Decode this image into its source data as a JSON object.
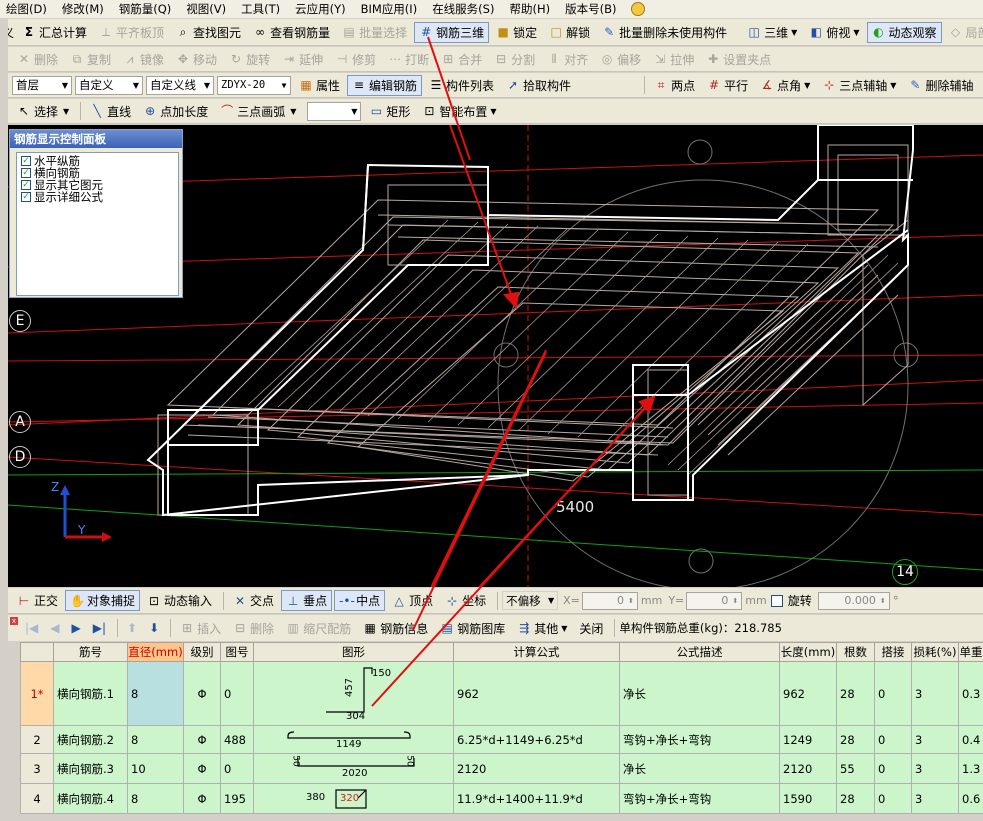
{
  "menu": [
    "绘图(D)",
    "修改(M)",
    "钢筋量(Q)",
    "视图(V)",
    "工具(T)",
    "云应用(Y)",
    "BIM应用(I)",
    "在线服务(S)",
    "帮助(H)",
    "版本号(B)"
  ],
  "toolbar1": {
    "partial_left": "义",
    "sum": "汇总计算",
    "flush": "平齐板顶",
    "find": "查找图元",
    "view_rebar": "查看钢筋量",
    "batch_select": "批量选择",
    "rebar3d": "钢筋三维",
    "lock": "锁定",
    "unlock": "解锁",
    "batch_delete": "批量删除未使用构件",
    "three_d": "三维",
    "top_view": "俯视",
    "orbit": "动态观察",
    "local3d": "局部三维"
  },
  "toolbar2": {
    "delete": "删除",
    "copy": "复制",
    "mirror": "镜像",
    "move": "移动",
    "rotate": "旋转",
    "extend": "延伸",
    "trim": "修剪",
    "break": "打断",
    "merge": "合并",
    "split": "分割",
    "align": "对齐",
    "offset": "偏移",
    "stretch": "拉伸",
    "set_point": "设置夹点"
  },
  "toolbar3": {
    "floor": "首层",
    "cat": "自定义",
    "subcat": "自定义线",
    "code": "ZDYX-20",
    "prop": "属性",
    "edit_rebar": "编辑钢筋",
    "comp_list": "构件列表",
    "pick": "拾取构件",
    "two_pt": "两点",
    "parallel": "平行",
    "pt_angle": "点角",
    "three_pt_axis": "三点辅轴",
    "del_axis": "删除辅轴"
  },
  "toolbar4": {
    "select": "选择",
    "line": "直线",
    "add_len": "点加长度",
    "arc": "三点画弧",
    "rect": "矩形",
    "smart": "智能布置"
  },
  "panel": {
    "title": "钢筋显示控制面板",
    "items": [
      "水平纵筋",
      "横向钢筋",
      "显示其它图元",
      "显示详细公式"
    ]
  },
  "viewport": {
    "axes": [
      "E",
      "A",
      "D"
    ],
    "dim": "5400",
    "grid_num": "14",
    "axis_z": "Z",
    "axis_y": "Y"
  },
  "snapbar": {
    "ortho": "正交",
    "snap": "对象捕捉",
    "dyn": "动态输入",
    "intersect": "交点",
    "perp": "垂点",
    "mid": "中点",
    "vertex": "顶点",
    "coord": "坐标",
    "offset": "不偏移",
    "x_label": "X=",
    "x_val": "0",
    "y_label": "Y=",
    "y_val": "0",
    "unit": "mm",
    "rotate": "旋转",
    "rot_val": "0.000",
    "deg": "°"
  },
  "gridtb": {
    "insert": "插入",
    "delete": "删除",
    "scale": "缩尺配筋",
    "info": "钢筋信息",
    "lib": "钢筋图库",
    "other": "其他",
    "close": "关闭",
    "total": "单构件钢筋总重(kg)：218.785"
  },
  "table": {
    "headers": [
      "",
      "筋号",
      "直径(mm)",
      "级别",
      "图号",
      "图形",
      "计算公式",
      "公式描述",
      "长度(mm)",
      "根数",
      "搭接",
      "损耗(%)",
      "单重"
    ],
    "rows": [
      {
        "n": "1*",
        "name": "横向钢筋.1",
        "d": "8",
        "grade": "Φ",
        "fig": "0",
        "shape": {
          "a": "457",
          "b": "150",
          "c": "304"
        },
        "formula": "962",
        "desc": "净长",
        "len": "962",
        "cnt": "28",
        "lap": "0",
        "loss": "3",
        "unit": "0.3"
      },
      {
        "n": "2",
        "name": "横向钢筋.2",
        "d": "8",
        "grade": "Φ",
        "fig": "488",
        "shape": {
          "a": "1149"
        },
        "formula": "6.25*d+1149+6.25*d",
        "desc": "弯钩+净长+弯钩",
        "len": "1249",
        "cnt": "28",
        "lap": "0",
        "loss": "3",
        "unit": "0.4"
      },
      {
        "n": "3",
        "name": "横向钢筋.3",
        "d": "10",
        "grade": "Φ",
        "fig": "0",
        "shape": {
          "a": "50",
          "b": "2020",
          "c": "50"
        },
        "formula": "2120",
        "desc": "净长",
        "len": "2120",
        "cnt": "55",
        "lap": "0",
        "loss": "3",
        "unit": "1.3"
      },
      {
        "n": "4",
        "name": "横向钢筋.4",
        "d": "8",
        "grade": "Φ",
        "fig": "195",
        "shape": {
          "a": "380",
          "b": "320"
        },
        "formula": "11.9*d+1400+11.9*d",
        "desc": "弯钩+净长+弯钩",
        "len": "1590",
        "cnt": "28",
        "lap": "0",
        "loss": "3",
        "unit": "0.6"
      }
    ]
  }
}
